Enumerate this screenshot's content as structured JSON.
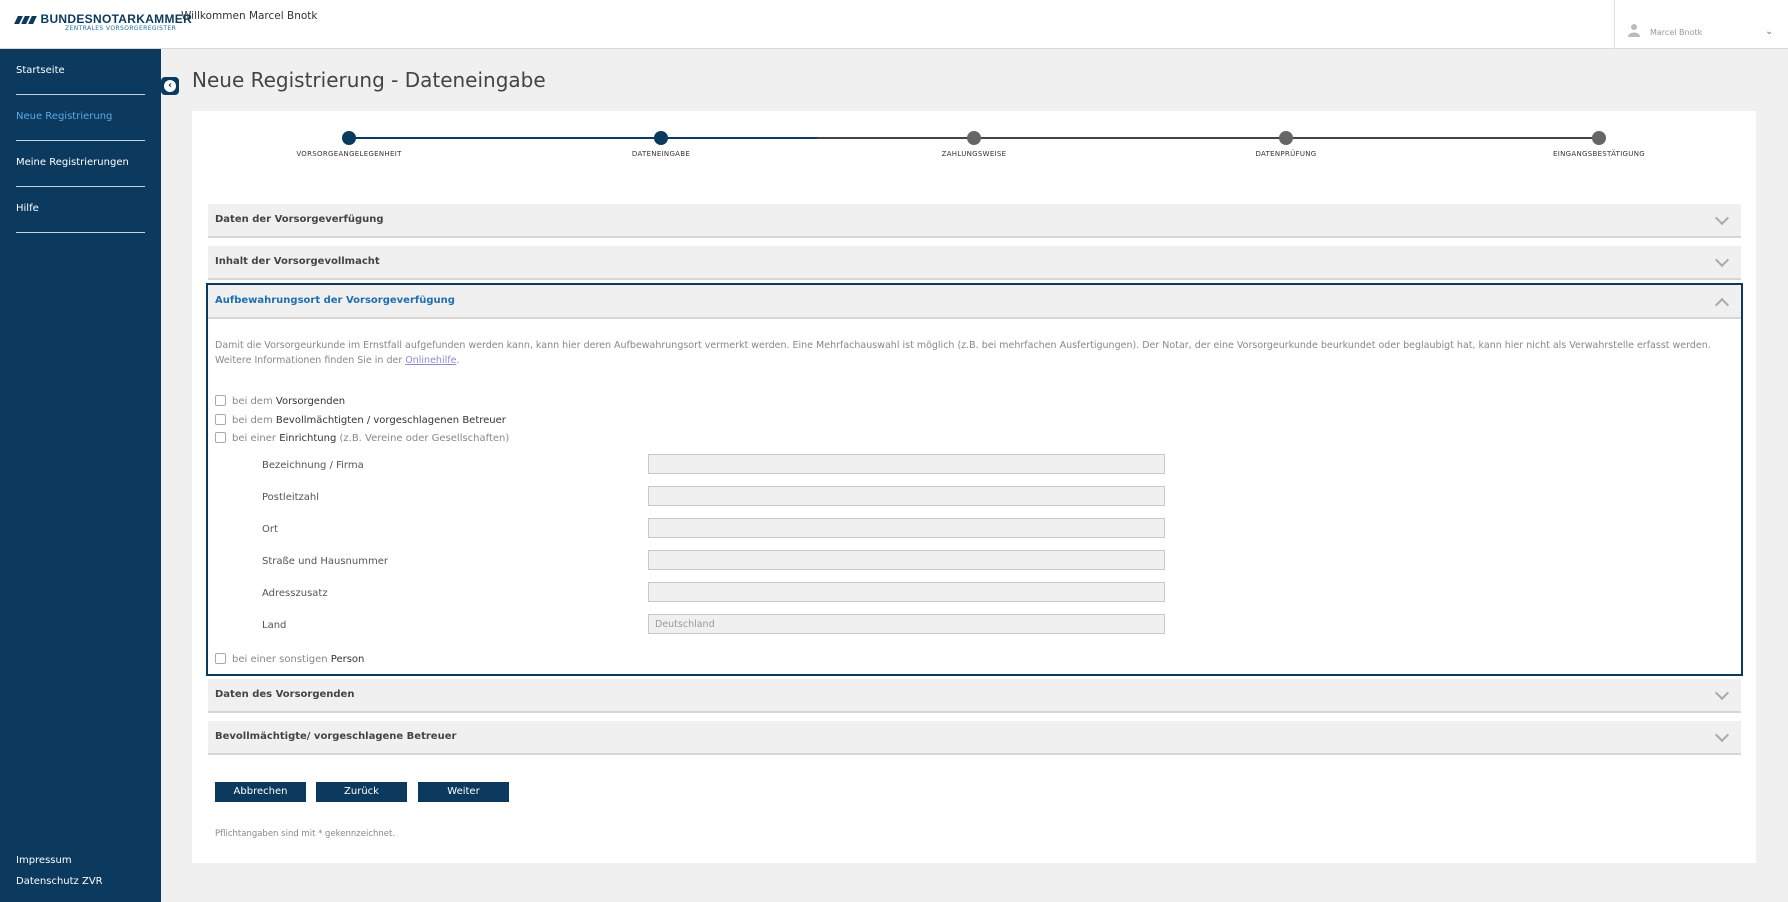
{
  "header": {
    "logo_main": "BUNDESNOTARKAMMER",
    "logo_sub": "ZENTRALES VORSORGEREGISTER",
    "welcome": "Willkommen Marcel Bnotk",
    "user_name": "Marcel Bnotk"
  },
  "sidebar": {
    "items": [
      {
        "label": "Startseite"
      },
      {
        "label": "Neue Registrierung"
      },
      {
        "label": "Meine Registrierungen"
      },
      {
        "label": "Hilfe"
      }
    ],
    "footer": [
      "Impressum",
      "Datenschutz ZVR"
    ]
  },
  "page": {
    "title": "Neue Registrierung - Dateneingabe"
  },
  "stepper": {
    "steps": [
      {
        "label": "VORSORGEANGELEGENHEIT",
        "state": "done"
      },
      {
        "label": "DATENEINGABE",
        "state": "current"
      },
      {
        "label": "ZAHLUNGSWEISE",
        "state": "pending"
      },
      {
        "label": "DATENPRÜFUNG",
        "state": "pending"
      },
      {
        "label": "EINGANGSBESTÄTIGUNG",
        "state": "pending"
      }
    ],
    "active_color": "#0b3a5e",
    "pending_color": "#666666"
  },
  "accordion": {
    "sections": [
      {
        "title": "Daten der Vorsorgeverfügung"
      },
      {
        "title": "Inhalt der Vorsorgevollmacht"
      },
      {
        "title": "Aufbewahrungsort der Vorsorgeverfügung"
      },
      {
        "title": "Daten des Vorsorgenden"
      },
      {
        "title": "Bevollmächtigte/ vorgeschlagene Betreuer"
      }
    ]
  },
  "storage": {
    "description": "Damit die Vorsorgeurkunde im Ernstfall aufgefunden werden kann, kann hier deren Aufbewahrungsort vermerkt werden. Eine Mehrfachauswahl ist möglich (z.B. bei mehrfachen Ausfertigungen). Der Notar, der eine Vorsorgeurkunde beurkundet oder beglaubigt hat, kann hier nicht als Verwahrstelle erfasst werden. Weitere Informationen finden Sie in der",
    "help_link": "Onlinehilfe",
    "options": [
      {
        "prefix": "bei dem",
        "strong": "Vorsorgenden",
        "hint": ""
      },
      {
        "prefix": "bei dem",
        "strong": "Bevollmächtigten / vorgeschlagenen Betreuer",
        "hint": ""
      },
      {
        "prefix": "bei einer",
        "strong": "Einrichtung",
        "hint": "(z.B. Vereine oder Gesellschaften)"
      },
      {
        "prefix": "bei einer sonstigen",
        "strong": "Person",
        "hint": ""
      }
    ],
    "fields": [
      {
        "label": "Bezeichnung / Firma",
        "value": ""
      },
      {
        "label": "Postleitzahl",
        "value": ""
      },
      {
        "label": "Ort",
        "value": ""
      },
      {
        "label": "Straße und Hausnummer",
        "value": ""
      },
      {
        "label": "Adresszusatz",
        "value": ""
      },
      {
        "label": "Land",
        "value": "Deutschland"
      }
    ]
  },
  "buttons": {
    "cancel": "Abbrechen",
    "back": "Zurück",
    "next": "Weiter"
  },
  "footnote": "Pflichtangaben sind mit * gekennzeichnet."
}
